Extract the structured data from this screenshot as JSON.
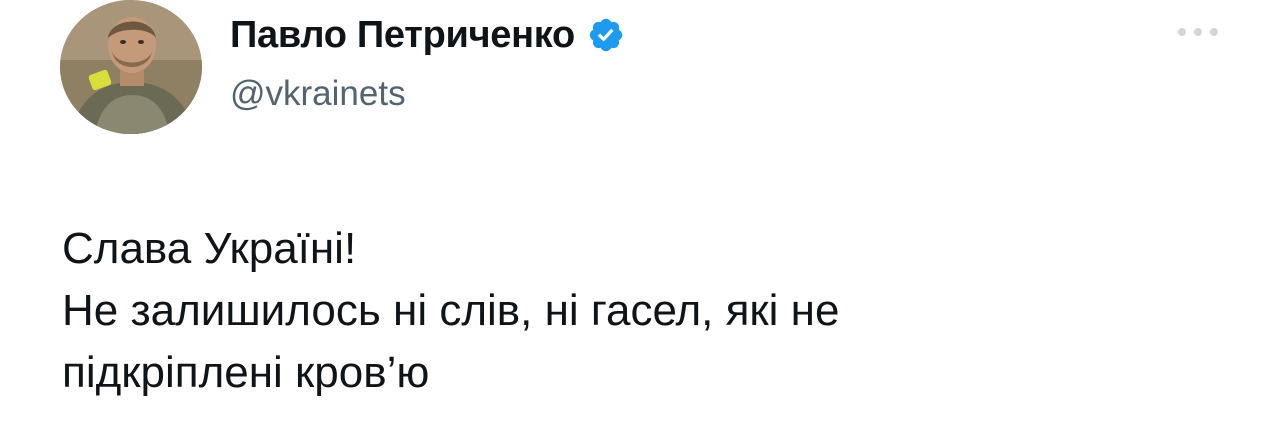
{
  "author": {
    "display_name": "Павло Петриченко",
    "handle": "@vkrainets",
    "verified": true
  },
  "tweet": {
    "lines": [
      "Слава Україні!",
      "Не залишилось ні слів, ні гасел, які не",
      "підкріплені кров’ю"
    ]
  },
  "colors": {
    "verified_badge": "#1d9bf0",
    "handle_text": "#536471",
    "more_dots": "#cfd9de"
  },
  "icons": {
    "verified": "verified-badge-icon",
    "more": "more-options-icon"
  }
}
